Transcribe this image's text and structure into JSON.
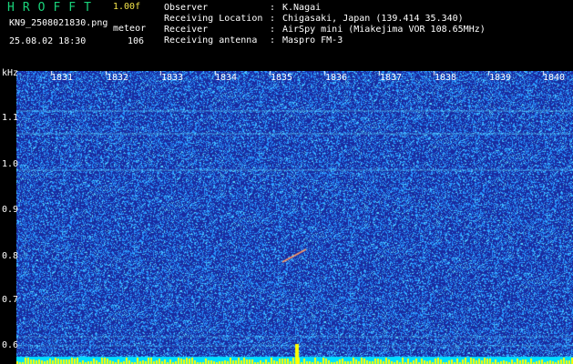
{
  "header": {
    "app_title": "HROFFT",
    "version": "1.00f",
    "file_name": "KN9_2508021830.png",
    "mode": "meteor",
    "datetime": "25.08.02 18:30",
    "count": "106",
    "info": [
      {
        "key": "Observer",
        "value": "K.Nagai"
      },
      {
        "key": "Receiving Location",
        "value": "Chigasaki, Japan (139.414 35.340)"
      },
      {
        "key": "Receiver",
        "value": "AirSpy mini (Miakejima VOR 108.65MHz)"
      },
      {
        "key": "Receiving antenna",
        "value": "Maspro FM-3"
      }
    ]
  },
  "spectrogram": {
    "unit": "kHz",
    "y_ticks": [
      "1.1",
      "1.0",
      "0.9",
      "0.8",
      "0.7",
      "0.6"
    ],
    "x_ticks": [
      "1831",
      "1832",
      "1833",
      "1834",
      "1835",
      "1836",
      "1837",
      "1838",
      "1839",
      "1840"
    ],
    "colors": {
      "background": "#1a2aa0",
      "noise": "#2fa0ff",
      "line": "#66e0ff",
      "bottom_band": "#00dfff",
      "peaks": "#ffff00"
    }
  }
}
